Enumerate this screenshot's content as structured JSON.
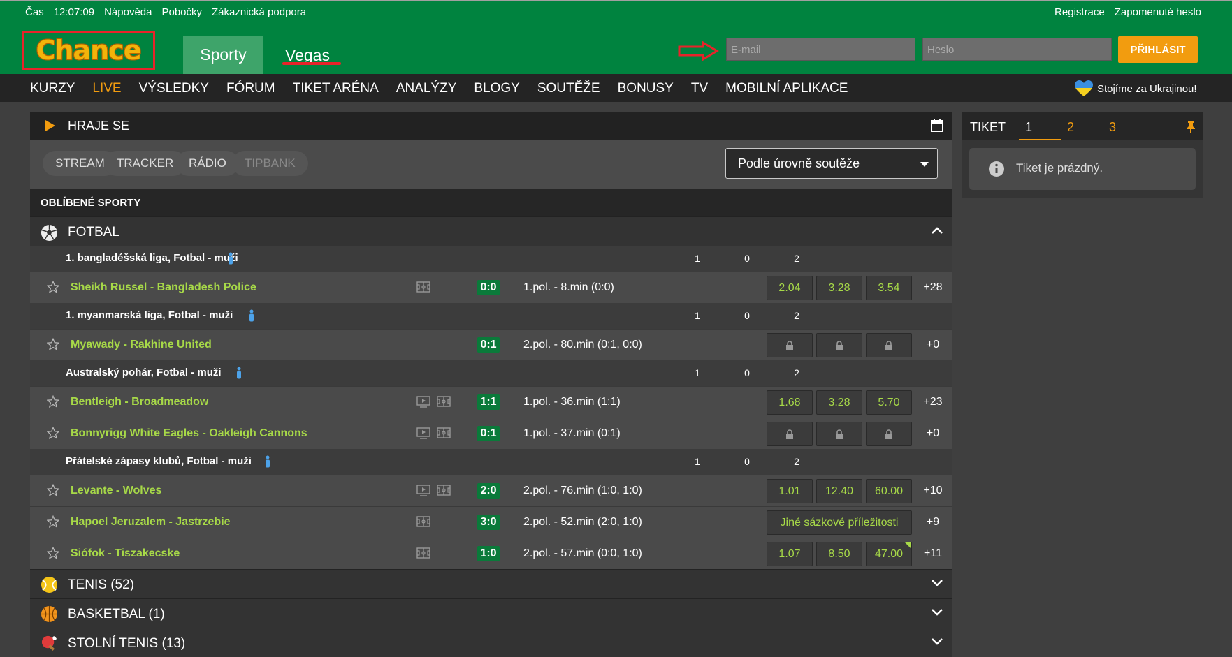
{
  "topbar": {
    "cas_label": "Čas",
    "time": "12:07:09",
    "help": "Nápověda",
    "branches": "Pobočky",
    "support": "Zákaznická podpora",
    "register": "Registrace",
    "forgot": "Zapomenuté heslo"
  },
  "header": {
    "logo": "Chance",
    "tab_sporty": "Sporty",
    "tab_vegas": "Vegas",
    "email_placeholder": "E-mail",
    "password_placeholder": "Heslo",
    "login": "PŘIHLÁSIT"
  },
  "nav": {
    "items": [
      "KURZY",
      "LIVE",
      "VÝSLEDKY",
      "FÓRUM",
      "TIKET ARÉNA",
      "ANALÝZY",
      "BLOGY",
      "SOUTĚŽE",
      "BONUSY",
      "TV",
      "MOBILNÍ APLIKACE"
    ],
    "ukraine": "Stojíme za Ukrajinou!"
  },
  "main": {
    "playing": "HRAJE SE",
    "filters": [
      "STREAM",
      "TRACKER",
      "RÁDIO",
      "TIPBANK"
    ],
    "sort": "Podle úrovně soutěže",
    "favorites": "OBLÍBENÉ SPORTY",
    "football": "FOTBAL",
    "odds_headers": [
      "1",
      "0",
      "2"
    ],
    "leagues": [
      {
        "name": "1. bangladéšská liga, Fotbal - muži",
        "matches": [
          {
            "teams": "Sheikh Russel - Bangladesh Police",
            "score": "0:0",
            "time": "1.pol. - 8.min (0:0)",
            "odds": [
              "2.04",
              "3.28",
              "3.54"
            ],
            "more": "+28"
          }
        ]
      },
      {
        "name": "1. myanmarská liga, Fotbal - muži",
        "matches": [
          {
            "teams": "Myawady - Rakhine United",
            "score": "0:1",
            "time": "2.pol. - 80.min (0:1, 0:0)",
            "more": "+0"
          }
        ]
      },
      {
        "name": "Australský pohár, Fotbal - muži",
        "matches": [
          {
            "teams": "Bentleigh - Broadmeadow",
            "score": "1:1",
            "time": "1.pol. - 36.min (1:1)",
            "odds": [
              "1.68",
              "3.28",
              "5.70"
            ],
            "more": "+23"
          },
          {
            "teams": "Bonnyrigg White Eagles - Oakleigh Cannons",
            "score": "0:1",
            "time": "1.pol. - 37.min (0:1)",
            "more": "+0"
          }
        ]
      },
      {
        "name": "Přátelské zápasy klubů, Fotbal - muži",
        "matches": [
          {
            "teams": "Levante - Wolves",
            "score": "2:0",
            "time": "2.pol. - 76.min (1:0, 1:0)",
            "odds": [
              "1.01",
              "12.40",
              "60.00"
            ],
            "more": "+10"
          },
          {
            "teams": "Hapoel Jeruzalem - Jastrzebie",
            "score": "3:0",
            "time": "2.pol. - 52.min (2:0, 1:0)",
            "other": "Jiné sázkové příležitosti",
            "more": "+9"
          },
          {
            "teams": "Siófok - Tiszakecske",
            "score": "1:0",
            "time": "2.pol. - 57.min (0:0, 1:0)",
            "odds": [
              "1.07",
              "8.50",
              "47.00"
            ],
            "more": "+11"
          }
        ]
      }
    ],
    "other_sports": [
      "TENIS (52)",
      "BASKETBAL (1)",
      "STOLNÍ TENIS (13)"
    ]
  },
  "ticket": {
    "label": "TIKET",
    "tabs": [
      "1",
      "2",
      "3"
    ],
    "empty": "Tiket je prázdný."
  }
}
